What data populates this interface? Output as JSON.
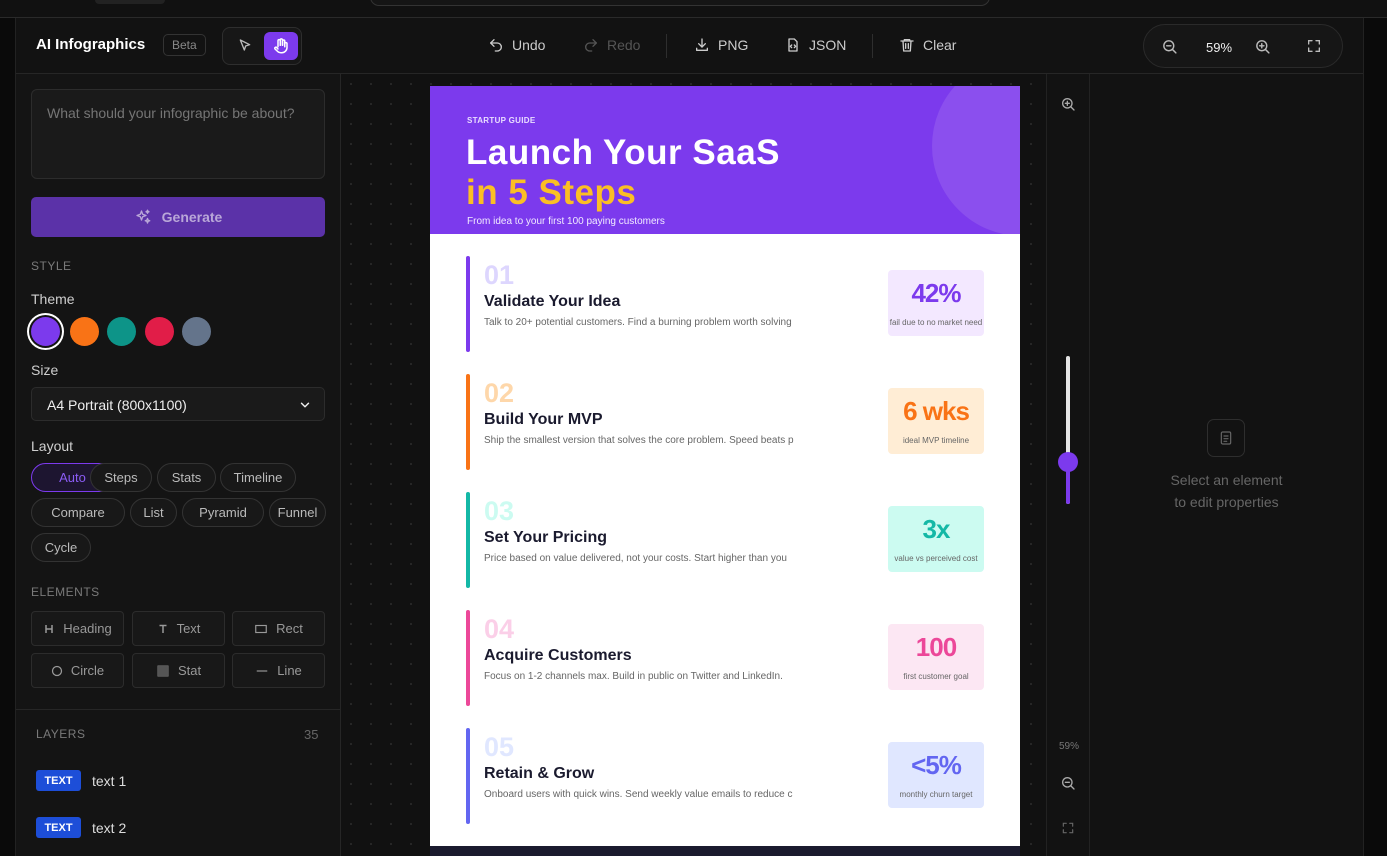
{
  "header": {
    "app_title": "AI Infographics",
    "beta_label": "Beta",
    "undo_label": "Undo",
    "redo_label": "Redo",
    "png_label": "PNG",
    "json_label": "JSON",
    "clear_label": "Clear",
    "zoom_value": "59%"
  },
  "sidebar": {
    "prompt_placeholder": "What should your infographic be about?",
    "generate_label": "Generate",
    "style_heading": "STYLE",
    "theme_label": "Theme",
    "themes": [
      "#7c3aed",
      "#f97316",
      "#0d9488",
      "#e11d48",
      "#64748b"
    ],
    "size_label": "Size",
    "size_value": "A4 Portrait (800x1100)",
    "layout_label": "Layout",
    "layouts": [
      "Auto",
      "Steps",
      "Stats",
      "Timeline",
      "Compare",
      "List",
      "Pyramid",
      "Funnel",
      "Cycle"
    ],
    "active_layout": "Auto",
    "elements_heading": "ELEMENTS",
    "elements": [
      "Heading",
      "Text",
      "Rect",
      "Circle",
      "Stat",
      "Line"
    ],
    "layers_heading": "LAYERS",
    "layers_count": "35",
    "layers": [
      {
        "type": "TEXT",
        "name": "text 1"
      },
      {
        "type": "TEXT",
        "name": "text 2"
      }
    ]
  },
  "poster": {
    "kicker": "STARTUP GUIDE",
    "title_line1": "Launch Your SaaS",
    "title_line2": "in 5 Steps",
    "subtitle": "From idea to your first 100 paying customers",
    "steps": [
      {
        "num": "01",
        "title": "Validate Your Idea",
        "desc": "Talk to 20+ potential customers. Find a burning problem worth solving",
        "stat": "42%",
        "stat_label": "fail due to no market need",
        "color": "#7c3aed",
        "num_color": "#ddd6fe",
        "stat_bg": "#f3e8ff",
        "stat_color": "#7c3aed"
      },
      {
        "num": "02",
        "title": "Build Your MVP",
        "desc": "Ship the smallest version that solves the core problem. Speed beats p",
        "stat": "6 wks",
        "stat_label": "ideal MVP timeline",
        "color": "#f97316",
        "num_color": "#fed7aa",
        "stat_bg": "#ffedd5",
        "stat_color": "#f97316"
      },
      {
        "num": "03",
        "title": "Set Your Pricing",
        "desc": "Price based on value delivered, not your costs. Start higher than you",
        "stat": "3x",
        "stat_label": "value vs perceived cost",
        "color": "#14b8a6",
        "num_color": "#ccfbf1",
        "stat_bg": "#ccfbf1",
        "stat_color": "#14b8a6"
      },
      {
        "num": "04",
        "title": "Acquire Customers",
        "desc": "Focus on 1-2 channels max. Build in public on Twitter and LinkedIn.",
        "stat": "100",
        "stat_label": "first customer goal",
        "color": "#ec4899",
        "num_color": "#fbcfe8",
        "stat_bg": "#fce7f3",
        "stat_color": "#ec4899"
      },
      {
        "num": "05",
        "title": "Retain & Grow",
        "desc": "Onboard users with quick wins. Send weekly value emails to reduce c",
        "stat": "<5%",
        "stat_label": "monthly churn target",
        "color": "#6366f1",
        "num_color": "#e0e7ff",
        "stat_bg": "#e0e7ff",
        "stat_color": "#6366f1"
      }
    ]
  },
  "zoom_strip": {
    "zoom_label": "59%",
    "zoom_level": 0.59
  },
  "properties": {
    "empty_line1": "Select an element",
    "empty_line2": "to edit properties"
  }
}
